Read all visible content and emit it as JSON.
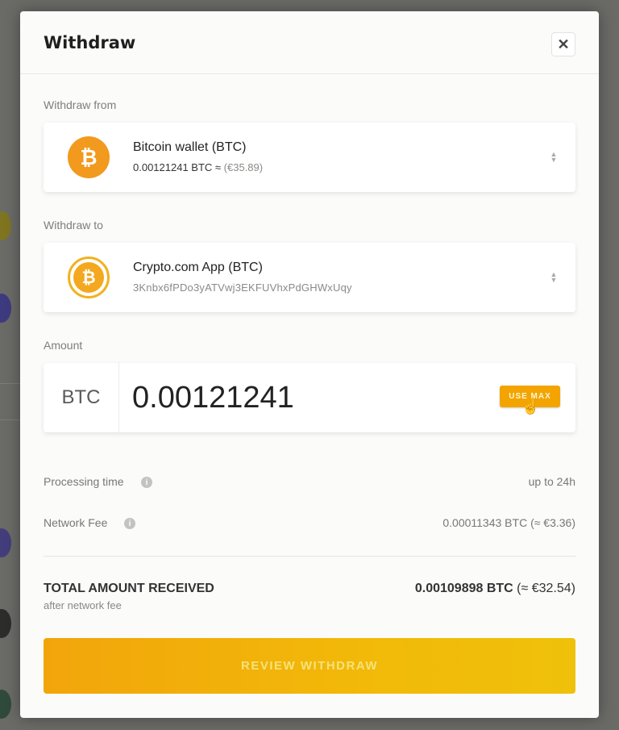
{
  "modal": {
    "title": "Withdraw",
    "close_icon": "close-icon"
  },
  "withdraw_from": {
    "label": "Withdraw from",
    "icon": "bitcoin-icon",
    "title": "Bitcoin wallet (BTC)",
    "balance": "0.00121241 BTC ≈",
    "fiat": "(€35.89)"
  },
  "withdraw_to": {
    "label": "Withdraw to",
    "icon": "bitcoin-icon",
    "title": "Crypto.com App (BTC)",
    "address": "3Knbx6fPDo3yATVwj3EKFUVhxPdGHWxUqy"
  },
  "amount": {
    "label": "Amount",
    "currency": "BTC",
    "value": "0.00121241",
    "use_max_label": "USE MAX"
  },
  "processing_time": {
    "label": "Processing time",
    "value": "up to 24h"
  },
  "network_fee": {
    "label": "Network Fee",
    "value": "0.00011343 BTC (≈ €3.36)"
  },
  "total": {
    "label": "TOTAL AMOUNT RECEIVED",
    "sublabel": "after network fee",
    "value_btc": "0.00109898 BTC",
    "value_fiat": "(≈ €32.54)"
  },
  "review_button_label": "REVIEW WITHDRAW",
  "colors": {
    "accent": "#f3a400",
    "bitcoin": "#f19a1d",
    "modal_bg": "#fbfbfa",
    "overlay": "#5a5a58"
  }
}
